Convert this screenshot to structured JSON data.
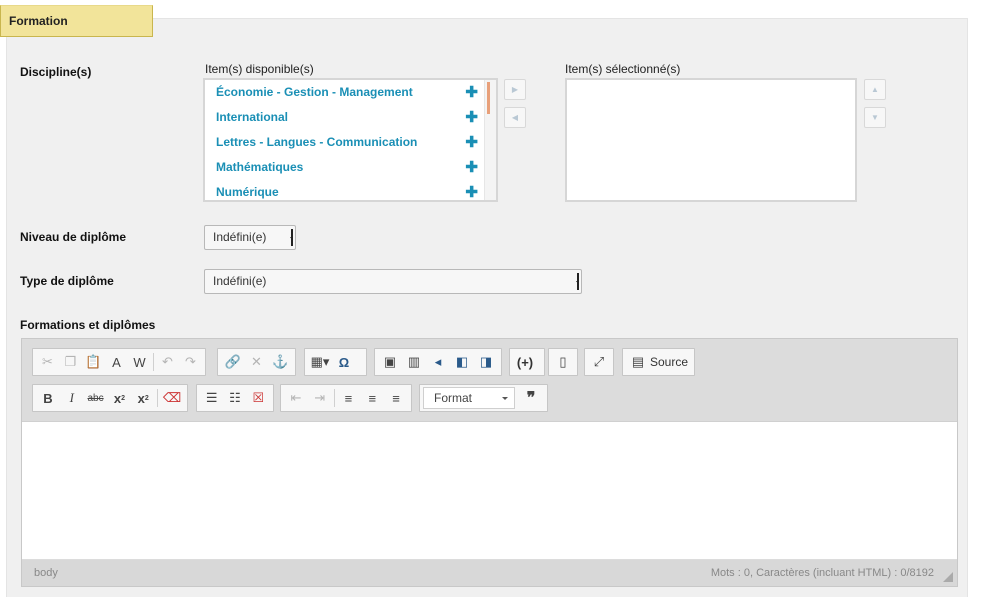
{
  "section": {
    "title": "Formation"
  },
  "discipline": {
    "label": "Discipline(s)",
    "available_label": "Item(s) disponible(s)",
    "selected_label": "Item(s) sélectionné(s)",
    "items": [
      {
        "label": "Économie - Gestion - Management",
        "icon": "plus-icon"
      },
      {
        "label": "International",
        "icon": "plus-icon"
      },
      {
        "label": "Lettres - Langues - Communication",
        "icon": "plus-icon"
      },
      {
        "label": "Mathématiques",
        "icon": "plus-icon"
      },
      {
        "label": "Numérique",
        "icon": "plus-icon"
      }
    ],
    "selected_items": [],
    "accent_color": "#1a8fb5"
  },
  "niveau": {
    "label": "Niveau de diplôme",
    "value": "Indéfini(e)"
  },
  "type": {
    "label": "Type de diplôme",
    "value": "Indéfini(e)"
  },
  "editor": {
    "label": "Formations et diplômes",
    "source_label": "Source",
    "format_label": "Format",
    "path": "body",
    "counter": "Mots : 0, Caractères (incluant HTML) : 0/8192"
  }
}
